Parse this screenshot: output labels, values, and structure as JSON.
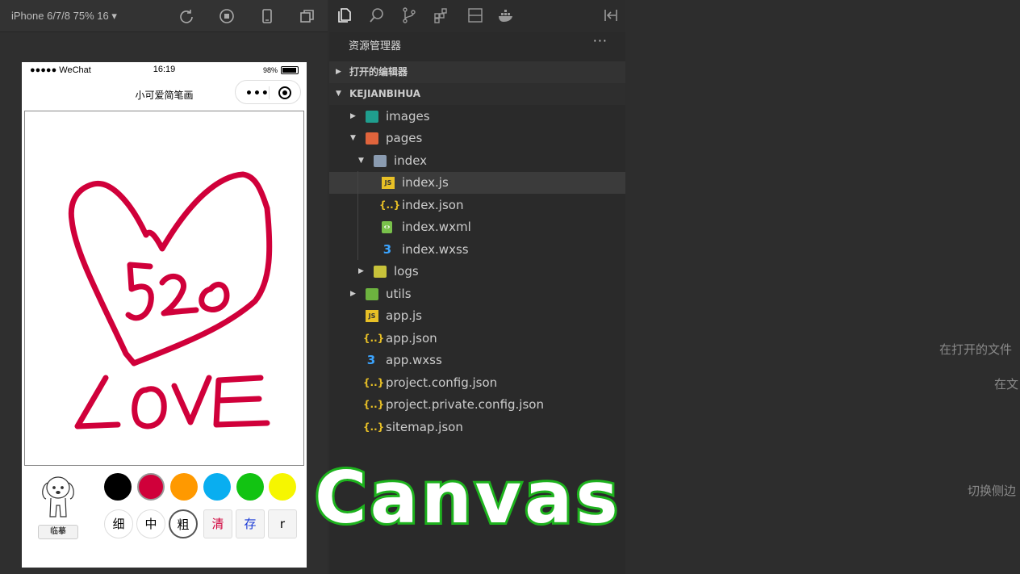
{
  "simulator": {
    "device_label": "iPhone 6/7/8 75% 16 ▾",
    "status": {
      "signal": "●●●●● WeChat",
      "time": "16:19",
      "battery": "98%"
    },
    "nav_title": "小可爱简笔画",
    "capsule_dots": "•••"
  },
  "app": {
    "tracing_label": "临摹",
    "colors": [
      {
        "name": "black",
        "hex": "#000000"
      },
      {
        "name": "crimson",
        "hex": "#d0003a"
      },
      {
        "name": "orange",
        "hex": "#ff9900"
      },
      {
        "name": "sky",
        "hex": "#09aef0"
      },
      {
        "name": "green",
        "hex": "#12c312"
      },
      {
        "name": "yellow",
        "hex": "#f6f600"
      }
    ],
    "tools": [
      "细",
      "中",
      "粗",
      "清",
      "存",
      "r"
    ],
    "drawing_text": [
      "520",
      "LOVE"
    ]
  },
  "explorer": {
    "title": "资源管理器",
    "more": "···",
    "sections": [
      {
        "label": "打开的编辑器",
        "expanded": false
      },
      {
        "label": "KEJIANBIHUA",
        "expanded": true
      }
    ],
    "tree": [
      {
        "name": "images",
        "type": "folder-images",
        "caret": "▶"
      },
      {
        "name": "pages",
        "type": "folder-pages",
        "caret": "▼"
      },
      {
        "name": "index",
        "type": "folder",
        "caret": "▼"
      },
      {
        "name": "index.js",
        "type": "js"
      },
      {
        "name": "index.json",
        "type": "json"
      },
      {
        "name": "index.wxml",
        "type": "wxml"
      },
      {
        "name": "index.wxss",
        "type": "wxss"
      },
      {
        "name": "logs",
        "type": "folder-logs",
        "caret": "▶"
      },
      {
        "name": "utils",
        "type": "folder-utils",
        "caret": "▶"
      },
      {
        "name": "app.js",
        "type": "js"
      },
      {
        "name": "app.json",
        "type": "json"
      },
      {
        "name": "app.wxss",
        "type": "wxss"
      },
      {
        "name": "project.config.json",
        "type": "json"
      },
      {
        "name": "project.private.config.json",
        "type": "json"
      },
      {
        "name": "sitemap.json",
        "type": "json"
      }
    ]
  },
  "editor_hints": [
    "在打开的文件",
    "在文",
    "切换侧边"
  ],
  "overlay_title": "Canvas",
  "accent": {
    "overlay_stroke": "#1db21d",
    "drawing_stroke": "#d0003a"
  }
}
